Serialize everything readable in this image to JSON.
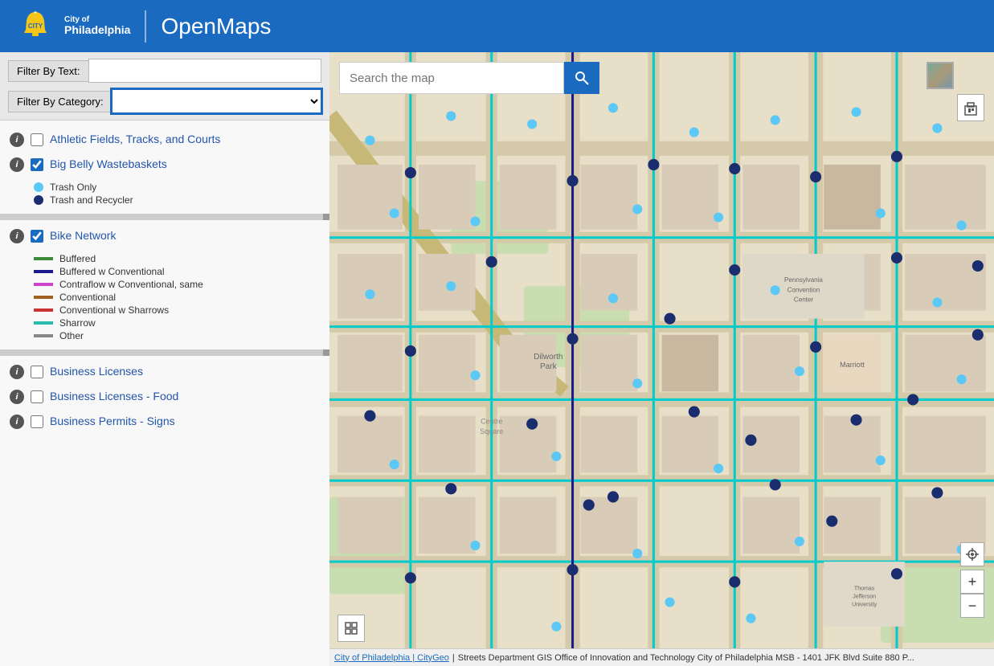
{
  "header": {
    "title": "OpenMaps",
    "city": "City of",
    "philadelphia": "Philadelphia"
  },
  "filters": {
    "text_label": "Filter By Text:",
    "text_placeholder": "",
    "category_label": "Filter By Category:",
    "category_value": ""
  },
  "layers": [
    {
      "id": "athletic-fields",
      "name": "Athletic Fields, Tracks, and Courts",
      "checked": false,
      "legend": []
    },
    {
      "id": "big-belly",
      "name": "Big Belly Wastebaskets",
      "checked": true,
      "legend": [
        {
          "type": "dot",
          "color": "#5bc8f5",
          "label": "Trash Only"
        },
        {
          "type": "dot",
          "color": "#1a2d6e",
          "label": "Trash and Recycler"
        }
      ]
    },
    {
      "id": "bike-network",
      "name": "Bike Network",
      "checked": true,
      "legend": [
        {
          "type": "line",
          "color": "#3a8a3a",
          "label": "Buffered"
        },
        {
          "type": "line",
          "color": "#1a1a8a",
          "label": "Buffered w Conventional"
        },
        {
          "type": "line",
          "color": "#cc44cc",
          "label": "Contraflow w Conventional, same"
        },
        {
          "type": "line",
          "color": "#a06020",
          "label": "Conventional"
        },
        {
          "type": "line",
          "color": "#cc3333",
          "label": "Conventional w Sharrows"
        },
        {
          "type": "line",
          "color": "#2abcaa",
          "label": "Sharrow"
        },
        {
          "type": "line",
          "color": "#888888",
          "label": "Other"
        }
      ]
    },
    {
      "id": "business-licenses",
      "name": "Business Licenses",
      "checked": false,
      "legend": []
    },
    {
      "id": "business-licenses-food",
      "name": "Business Licenses - Food",
      "checked": false,
      "legend": []
    },
    {
      "id": "business-permits-signs",
      "name": "Business Permits - Signs",
      "checked": false,
      "legend": []
    }
  ],
  "search": {
    "placeholder": "Search the map",
    "button_label": "🔍"
  },
  "status_bar": {
    "link_text": "City of Philadelphia | CityGeo",
    "separator": "|",
    "attribution": "Streets Department GIS Office of Innovation and Technology City of Philadelphia MSB - 1401 JFK Blvd Suite 880 P..."
  },
  "zoom": {
    "in_label": "+",
    "out_label": "−"
  }
}
